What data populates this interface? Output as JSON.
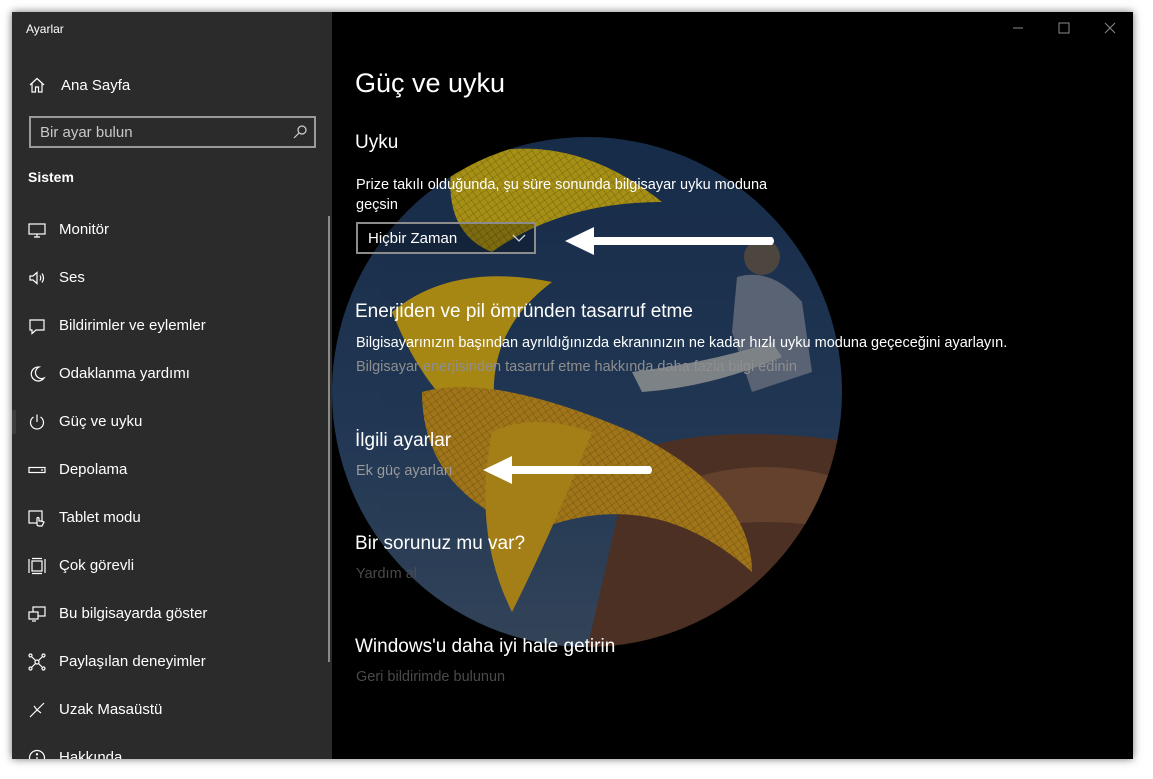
{
  "app": {
    "title": "Ayarlar"
  },
  "sidebar": {
    "home_label": "Ana Sayfa",
    "search_placeholder": "Bir ayar bulun",
    "section_title": "Sistem",
    "items": [
      {
        "label": "Monitör",
        "icon": "monitor-icon"
      },
      {
        "label": "Ses",
        "icon": "speaker-icon"
      },
      {
        "label": "Bildirimler ve eylemler",
        "icon": "notification-icon"
      },
      {
        "label": "Odaklanma yardımı",
        "icon": "moon-icon"
      },
      {
        "label": "Güç ve uyku",
        "icon": "power-icon",
        "selected": true
      },
      {
        "label": "Depolama",
        "icon": "storage-icon"
      },
      {
        "label": "Tablet modu",
        "icon": "tablet-icon"
      },
      {
        "label": "Çok görevli",
        "icon": "multitask-icon"
      },
      {
        "label": "Bu bilgisayarda göster",
        "icon": "project-icon"
      },
      {
        "label": "Paylaşılan deneyimler",
        "icon": "shared-icon"
      },
      {
        "label": "Uzak Masaüstü",
        "icon": "remote-desktop-icon"
      },
      {
        "label": "Hakkında",
        "icon": "info-icon"
      }
    ]
  },
  "main": {
    "title": "Güç ve uyku",
    "sleep": {
      "heading": "Uyku",
      "description": "Prize takılı olduğunda, şu süre sonunda bilgisayar uyku moduna geçsin",
      "selected_value": "Hiçbir Zaman"
    },
    "energy": {
      "heading": "Enerjiden ve pil ömründen tasarruf etme",
      "description": "Bilgisayarınızın başından ayrıldığınızda ekranınızın ne kadar hızlı uyku moduna geçeceğini ayarlayın.",
      "link": "Bilgisayar enerjisinden tasarruf etme hakkında daha fazla bilgi edinin"
    },
    "related": {
      "heading": "İlgili ayarlar",
      "link": "Ek güç ayarları"
    },
    "question": {
      "heading": "Bir sorunuz mu var?",
      "link": "Yardım al"
    },
    "improve": {
      "heading": "Windows'u daha iyi hale getirin",
      "link": "Geri bildirimde bulunun"
    }
  },
  "colors": {
    "sidebar_bg": "#2b2b2b",
    "content_bg": "#000000",
    "link_muted": "#8e8e8e",
    "arrow": "#ffffff"
  }
}
